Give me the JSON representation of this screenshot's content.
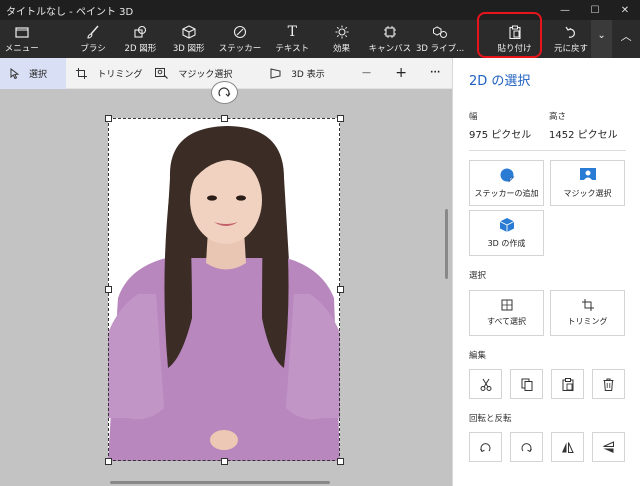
{
  "window": {
    "title": "タイトルなし - ペイント 3D",
    "minimize": "—",
    "maximize": "☐",
    "close": "✕"
  },
  "toolbar": {
    "menu": "メニュー",
    "brush": "ブラシ",
    "shapes2d": "2D 図形",
    "shapes3d": "3D 図形",
    "stickers": "ステッカー",
    "text": "テキスト",
    "effects": "効果",
    "canvas": "キャンバス",
    "library3d": "3D ライブ...",
    "paste": "貼り付け",
    "undo": "元に戻す",
    "more": "⌄",
    "collapse": "︿"
  },
  "subbar": {
    "select": "選択",
    "crop": "トリミング",
    "magic_select": "マジック選択",
    "view3d": "3D 表示",
    "zoom_out": "—",
    "zoom_in": "+",
    "more": "···"
  },
  "panel": {
    "title": "2D の選択",
    "width_label": "幅",
    "width_value": "975 ピクセル",
    "height_label": "高さ",
    "height_value": "1452 ピクセル",
    "add_sticker": "ステッカーの追加",
    "magic_select": "マジック選択",
    "make_3d": "3D の作成",
    "section_select": "選択",
    "select_all": "すべて選択",
    "crop": "トリミング",
    "section_edit": "編集",
    "section_rotate": "回転と反転"
  },
  "colors": {
    "accent": "#1f5fbf",
    "toolbar_bg": "#2b2b2b",
    "highlight": "#e8141b",
    "active_tab": "#d9dff4"
  }
}
